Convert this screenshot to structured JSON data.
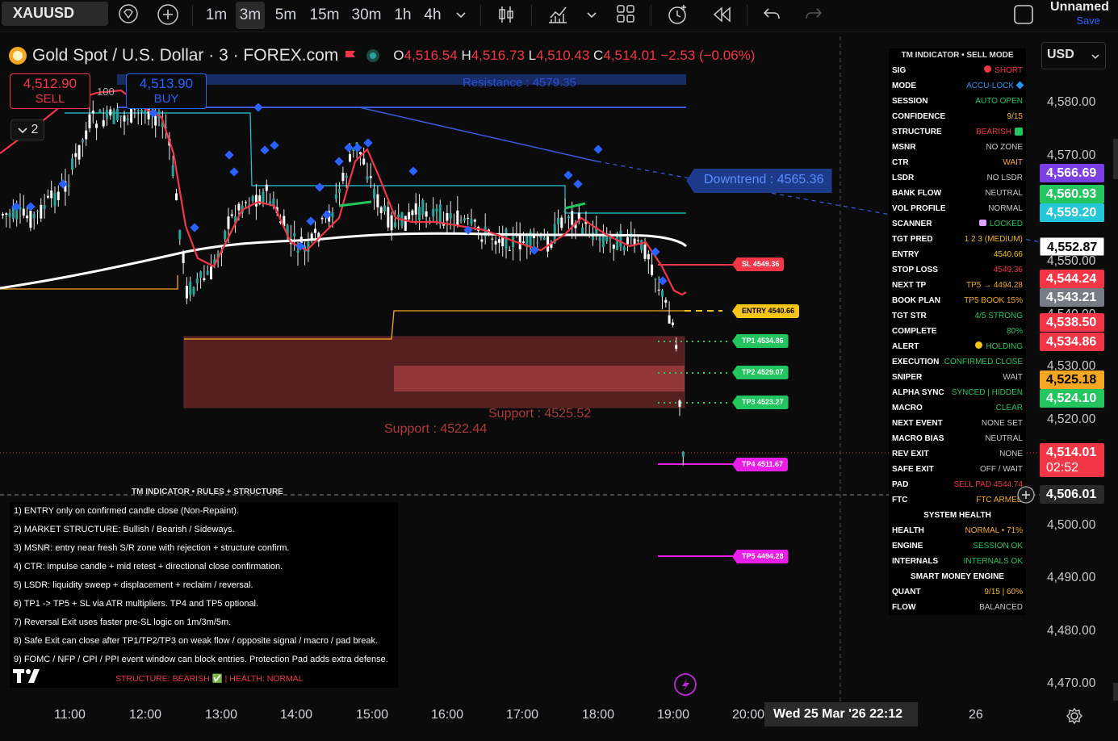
{
  "toolbar": {
    "symbol": "XAUUSD",
    "timeframes": [
      "1m",
      "3m",
      "5m",
      "15m",
      "30m",
      "1h",
      "4h"
    ],
    "active_timeframe": "3m",
    "layout_name": "Unnamed",
    "save_label": "Save"
  },
  "legend": {
    "title": "Gold Spot / U.S. Dollar · 3 · FOREX.com",
    "open_label": "O",
    "open": "4,516.54",
    "high_label": "H",
    "high": "4,516.73",
    "low_label": "L",
    "low": "4,510.43",
    "close_label": "C",
    "close": "4,514.01",
    "change": "−2.53 (−0.06%)"
  },
  "trade": {
    "sell_price": "4,512.90",
    "sell_label": "SELL",
    "buy_price": "4,513.90",
    "buy_label": "BUY",
    "spread": "100",
    "collapse_count": "2"
  },
  "annotations": {
    "resistance_top": "Resistance : 4579.35",
    "downtrend": "Downtrend : 4565.36",
    "support1": "Support : 4525.52",
    "support2": "Support : 4522.44",
    "sl": "SL 4549.36",
    "entry": "ENTRY 4540.66",
    "tp1": "TP1 4534.86",
    "tp2": "TP2 4529.07",
    "tp3": "TP3 4523.27",
    "tp4": "TP4 4511.67",
    "tp5": "TP5 4494.28"
  },
  "tm_panel": {
    "title": "TM INDICATOR • SELL MODE",
    "rows": [
      {
        "k": "SIG",
        "v": "SHORT",
        "c": "#f23645",
        "dot": "#f23645"
      },
      {
        "k": "MODE",
        "v": "ACCU-LOCK",
        "c": "#2196f3",
        "diamond": "#2196f3"
      },
      {
        "k": "SESSION",
        "v": "AUTO OPEN",
        "c": "#22c55e"
      },
      {
        "k": "CONFIDENCE",
        "v": "9/15",
        "c": "#f0b429"
      },
      {
        "k": "STRUCTURE",
        "v": "BEARISH",
        "c": "#f23645",
        "check": "#22c55e"
      },
      {
        "k": "MSNR",
        "v": "NO ZONE",
        "c": "#c8c8c8"
      },
      {
        "k": "CTR",
        "v": "WAIT",
        "c": "#f5a623"
      },
      {
        "k": "LSDR",
        "v": "NO LSDR",
        "c": "#c8c8c8"
      },
      {
        "k": "BANK FLOW",
        "v": "NEUTRAL",
        "c": "#c8c8c8"
      },
      {
        "k": "VOL PROFILE",
        "v": "NORMAL",
        "c": "#c8c8c8"
      },
      {
        "k": "SCANNER",
        "v": "LOCKED",
        "c": "#22c55e",
        "lock": "#e0a0ff"
      },
      {
        "k": "TGT PRED",
        "v": "1 2 3 (MEDIUM)",
        "c": "#f0b429"
      },
      {
        "k": "ENTRY",
        "v": "4540.66",
        "c": "#f5c518"
      },
      {
        "k": "STOP LOSS",
        "v": "4549.36",
        "c": "#f23645"
      },
      {
        "k": "NEXT TP",
        "v": "TP5 → 4494.28",
        "c": "#f5a623"
      },
      {
        "k": "BOOK PLAN",
        "v": "TP5 BOOK 15%",
        "c": "#f5a623"
      },
      {
        "k": "TGT STR",
        "v": "4/5 STRONG",
        "c": "#22c55e"
      },
      {
        "k": "COMPLETE",
        "v": "80%",
        "c": "#22c55e"
      },
      {
        "k": "ALERT",
        "v": "HOLDING",
        "c": "#22c55e",
        "emoji": "#f5c518"
      },
      {
        "k": "EXECUTION",
        "v": "CONFIRMED CLOSE",
        "c": "#22c55e"
      },
      {
        "k": "SNIPER",
        "v": "WAIT",
        "c": "#c8c8c8"
      },
      {
        "k": "ALPHA SYNC",
        "v": "SYNCED | HIDDEN",
        "c": "#22c55e"
      },
      {
        "k": "MACRO",
        "v": "CLEAR",
        "c": "#22c55e"
      },
      {
        "k": "NEXT EVENT",
        "v": "NONE SET",
        "c": "#c8c8c8"
      },
      {
        "k": "MACRO BIAS",
        "v": "NEUTRAL",
        "c": "#c8c8c8"
      },
      {
        "k": "REV EXIT",
        "v": "NONE",
        "c": "#c8c8c8"
      },
      {
        "k": "SAFE EXIT",
        "v": "OFF / WAIT",
        "c": "#c8c8c8"
      },
      {
        "k": "PAD",
        "v": "SELL PAD 4544.74",
        "c": "#f23645"
      },
      {
        "k": "FTC",
        "v": "FTC ARMED",
        "c": "#f5a623"
      }
    ],
    "health_title": "SYSTEM HEALTH",
    "health_rows": [
      {
        "k": "HEALTH",
        "v": "NORMAL • 71%",
        "c": "#f5a623"
      },
      {
        "k": "ENGINE",
        "v": "SESSION OK",
        "c": "#22c55e"
      },
      {
        "k": "INTERNALS",
        "v": "INTERNALS OK",
        "c": "#22c55e"
      }
    ],
    "smart_title": "SMART MONEY ENGINE",
    "smart_rows": [
      {
        "k": "QUANT",
        "v": "9/15 | 60%",
        "c": "#f0b429"
      },
      {
        "k": "FLOW",
        "v": "BALANCED",
        "c": "#c8c8c8"
      }
    ]
  },
  "price_scale": {
    "currency": "USD",
    "ticks": [
      "4,580.00",
      "4,570.00",
      "4,550.00",
      "4,540.00",
      "4,530.00",
      "4,520.00",
      "4,500.00",
      "4,490.00",
      "4,480.00",
      "4,470.00"
    ],
    "tags": [
      {
        "v": "4,566.69",
        "bg": "#7b3fe4"
      },
      {
        "v": "4,560.93",
        "bg": "#22c55e"
      },
      {
        "v": "4,559.20",
        "bg": "#26c6da"
      },
      {
        "v": "4,552.87",
        "bg": "#ffffff",
        "fg": "#000"
      },
      {
        "v": "4,544.24",
        "bg": "#f23645"
      },
      {
        "v": "4,543.21",
        "bg": "#787b86"
      },
      {
        "v": "4,538.50",
        "bg": "#f23645"
      },
      {
        "v": "4,534.86",
        "bg": "#f23645"
      },
      {
        "v": "4,525.18",
        "bg": "#f5a623",
        "fg": "#000"
      },
      {
        "v": "4,524.10",
        "bg": "#22c55e"
      },
      {
        "v": "4,514.01",
        "bg": "#f23645",
        "sub": "02:52"
      },
      {
        "v": "4,506.01",
        "bg": "#2a2a2a"
      }
    ]
  },
  "rules": {
    "title": "TM INDICATOR • RULES + STRUCTURE",
    "items": [
      "1) ENTRY only on confirmed candle close (Non-Repaint).",
      "2) MARKET STRUCTURE: Bullish / Bearish / Sideways.",
      "3) MSNR: entry near fresh S/R zone with rejection + structure confirm.",
      "4) CTR: impulse candle + mid retest + directional close confirmation.",
      "5) LSDR: liquidity sweep + displacement + reclaim / reversal.",
      "6) TP1 -> TP5 + SL via ATR multipliers. TP4 and TP5 optional.",
      "7) Reversal Exit uses faster pre-SL logic on 1m/3m/5m.",
      "8) Safe Exit can close after TP1/TP2/TP3 on weak flow / opposite signal / macro / pad break.",
      "9) FOMC / NFP / CPI / PPI event window can block entries. Protection Pad adds extra defense."
    ],
    "footer": "STRUCTURE: BEARISH ✅ | HEALTH: NORMAL"
  },
  "time_axis": {
    "labels": [
      "11:00",
      "12:00",
      "13:00",
      "14:00",
      "15:00",
      "16:00",
      "17:00",
      "18:00",
      "19:00",
      "20:00"
    ],
    "crosshair": "Wed 25 Mar '26   22:12",
    "next_day": "26"
  }
}
